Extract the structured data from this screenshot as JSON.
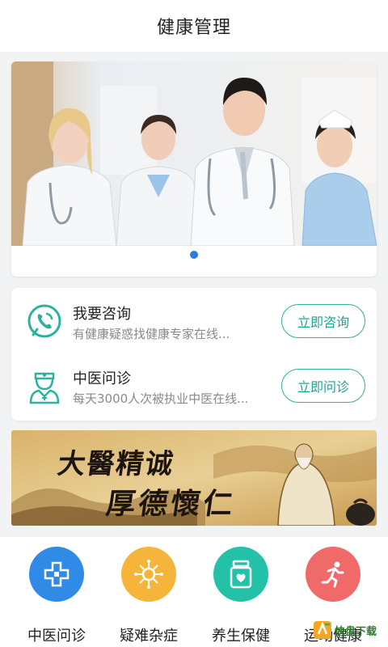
{
  "header": {
    "title": "健康管理"
  },
  "banner": {
    "dots_active_index": 0,
    "dots_count": 1
  },
  "consult": {
    "items": [
      {
        "title": "我要咨询",
        "subtitle": "有健康疑惑找健康专家在线...",
        "button": "立即咨询",
        "icon": "phone-chat-icon"
      },
      {
        "title": "中医问诊",
        "subtitle": "每天3000人次被执业中医在线...",
        "button": "立即问诊",
        "icon": "doctor-icon"
      }
    ]
  },
  "tcm_banner": {
    "calligraphy_line1": "大醫精诚",
    "calligraphy_line2": "厚德懷仁"
  },
  "grid": {
    "items": [
      {
        "label": "中医问诊",
        "color": "#2f8be6",
        "icon": "clinic-cross-icon"
      },
      {
        "label": "疑难杂症",
        "color": "#f5b53a",
        "icon": "virus-icon"
      },
      {
        "label": "养生保健",
        "color": "#23c2a8",
        "icon": "medicine-bottle-icon"
      },
      {
        "label": "运动健康",
        "color": "#f06a6a",
        "icon": "running-icon"
      }
    ]
  },
  "watermark": {
    "text": "快盘下载"
  },
  "colors": {
    "accent": "#2bb39e",
    "dot_active": "#2a7de1"
  }
}
